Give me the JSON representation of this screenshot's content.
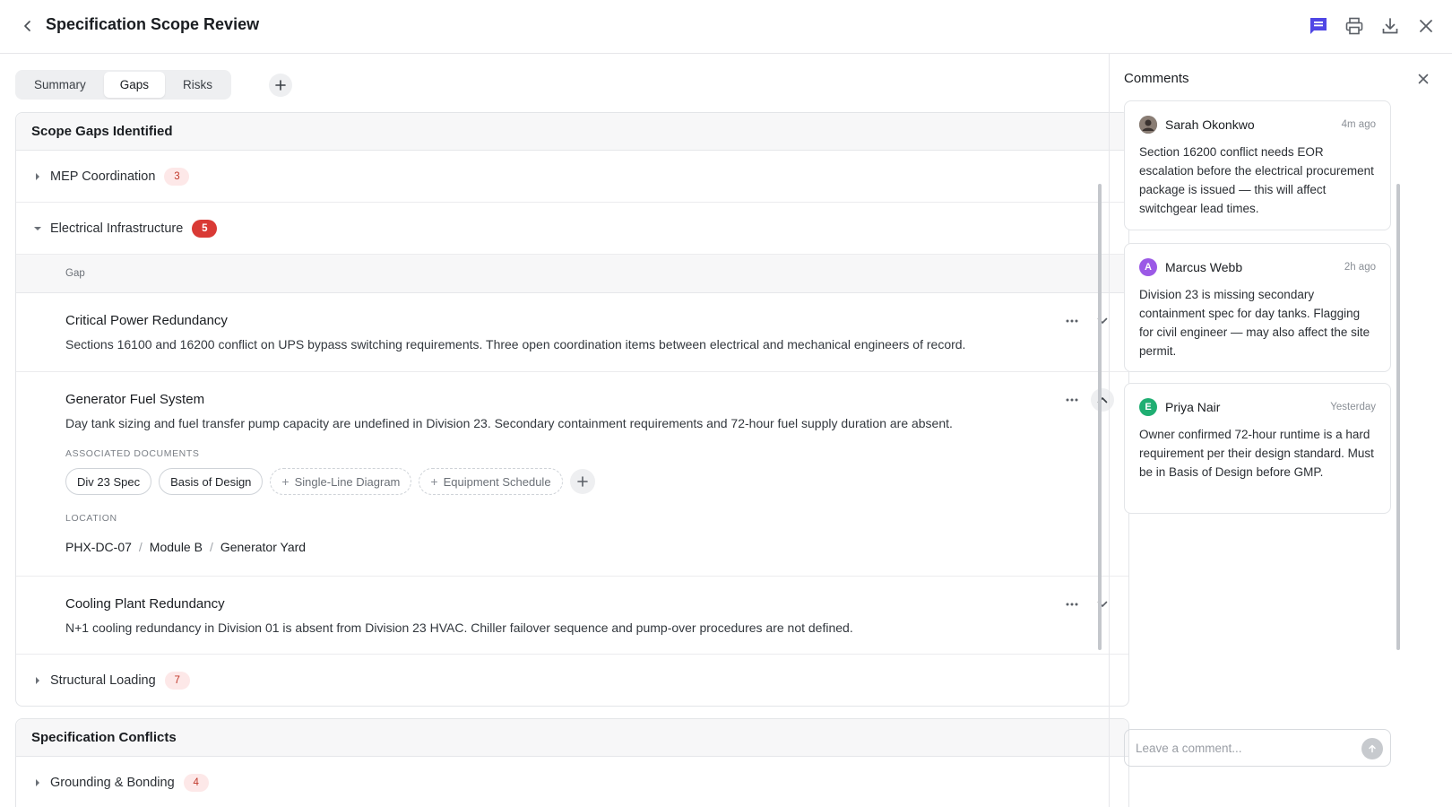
{
  "header": {
    "title": "Specification Scope Review"
  },
  "tabs": [
    {
      "label": "Summary"
    },
    {
      "label": "Gaps"
    },
    {
      "label": "Risks"
    }
  ],
  "scope_gaps": {
    "title": "Scope Gaps Identified",
    "groups": [
      {
        "label": "MEP Coordination",
        "count": "3"
      },
      {
        "label": "Electrical Infrastructure",
        "count": "5"
      },
      {
        "label": "Structural Loading",
        "count": "7"
      }
    ],
    "column_header": "Gap",
    "items": [
      {
        "title": "Critical Power Redundancy",
        "description": "Sections 16100 and 16200 conflict on UPS bypass switching requirements. Three open coordination items between electrical and mechanical engineers of record."
      },
      {
        "title": "Generator Fuel System",
        "description": "Day tank sizing and fuel transfer pump capacity are undefined in Division 23. Secondary containment requirements and 72-hour fuel supply duration are absent.",
        "associated_documents_label": "ASSOCIATED DOCUMENTS",
        "documents": [
          "Div 23 Spec",
          "Basis of Design"
        ],
        "suggested_documents": [
          "Single-Line Diagram",
          "Equipment Schedule"
        ],
        "location_label": "LOCATION",
        "location": [
          "PHX-DC-07",
          "Module B",
          "Generator Yard"
        ]
      },
      {
        "title": "Cooling Plant Redundancy",
        "description": "N+1 cooling redundancy in Division 01 is absent from Division 23 HVAC. Chiller failover sequence and pump-over procedures are not defined."
      }
    ]
  },
  "spec_conflicts": {
    "title": "Specification Conflicts",
    "groups": [
      {
        "label": "Grounding & Bonding",
        "count": "4"
      }
    ]
  },
  "comments_panel": {
    "title": "Comments",
    "input_placeholder": "Leave a comment...",
    "comments": [
      {
        "author": "Sarah Okonkwo",
        "time": "4m ago",
        "avatar_initial": "",
        "avatar_color": "#6b6f75",
        "body": "Section 16200 conflict needs EOR escalation before the electrical procurement package is issued — this will affect switchgear lead times."
      },
      {
        "author": "Marcus Webb",
        "time": "2h ago",
        "avatar_initial": "A",
        "avatar_color": "#9b59e6",
        "body": "Division 23 is missing secondary containment spec for day tanks. Flagging for civil engineer — may also affect the site permit."
      },
      {
        "author": "Priya Nair",
        "time": "Yesterday",
        "avatar_initial": "E",
        "avatar_color": "#1fae72",
        "body": "Owner confirmed 72-hour runtime is a hard requirement per their design standard. Must be in Basis of Design before GMP."
      }
    ]
  },
  "colors": {
    "accent": "#4f46e5",
    "badge_soft_bg": "#fde8e8",
    "badge_solid": "#d93a35"
  }
}
